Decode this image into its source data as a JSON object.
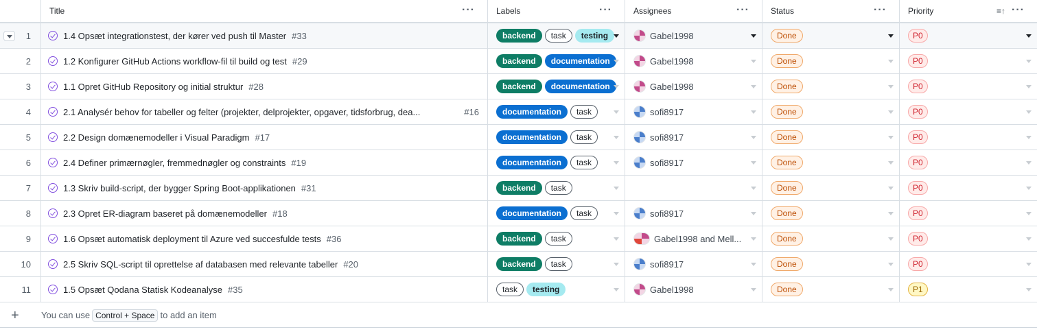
{
  "columns": {
    "title": "Title",
    "labels": "Labels",
    "assignees": "Assignees",
    "status": "Status",
    "priority": "Priority"
  },
  "header_menu_glyph": "···",
  "rows": [
    {
      "n": "1",
      "title": "1.4 Opsæt integrationstest, der kører ved push til Master",
      "issue": "#33",
      "labels": [
        "backend",
        "task",
        "testing"
      ],
      "assignee": "Gabel1998",
      "avatar": "pink",
      "status": "Done",
      "priority": "P0"
    },
    {
      "n": "2",
      "title": "1.2 Konfigurer GitHub Actions workflow-fil til build og test",
      "issue": "#29",
      "labels": [
        "backend",
        "documentation"
      ],
      "assignee": "Gabel1998",
      "avatar": "pink",
      "status": "Done",
      "priority": "P0"
    },
    {
      "n": "3",
      "title": "1.1 Opret GitHub Repository og initial struktur",
      "issue": "#28",
      "labels": [
        "backend",
        "documentation"
      ],
      "assignee": "Gabel1998",
      "avatar": "pink",
      "status": "Done",
      "priority": "P0"
    },
    {
      "n": "4",
      "title": "2.1 Analysér behov for tabeller og felter (projekter, delprojekter, opgaver, tidsforbrug, dea...",
      "issue": "#16",
      "labels": [
        "documentation",
        "task"
      ],
      "assignee": "sofi8917",
      "avatar": "blue",
      "status": "Done",
      "priority": "P0"
    },
    {
      "n": "5",
      "title": "2.2 Design domænemodeller i Visual Paradigm",
      "issue": "#17",
      "labels": [
        "documentation",
        "task"
      ],
      "assignee": "sofi8917",
      "avatar": "blue",
      "status": "Done",
      "priority": "P0"
    },
    {
      "n": "6",
      "title": "2.4 Definer primærnøgler, fremmednøgler og constraints",
      "issue": "#19",
      "labels": [
        "documentation",
        "task"
      ],
      "assignee": "sofi8917",
      "avatar": "blue",
      "status": "Done",
      "priority": "P0"
    },
    {
      "n": "7",
      "title": "1.3 Skriv build-script, der bygger Spring Boot-applikationen",
      "issue": "#31",
      "labels": [
        "backend",
        "task"
      ],
      "assignee": "",
      "avatar": "",
      "status": "Done",
      "priority": "P0"
    },
    {
      "n": "8",
      "title": "2.3 Opret ER-diagram baseret på domænemodeller",
      "issue": "#18",
      "labels": [
        "documentation",
        "task"
      ],
      "assignee": "sofi8917",
      "avatar": "blue",
      "status": "Done",
      "priority": "P0"
    },
    {
      "n": "9",
      "title": "1.6 Opsæt automatisk deployment til Azure ved succesfulde tests",
      "issue": "#36",
      "labels": [
        "backend",
        "task"
      ],
      "assignee": "Gabel1998 and Mell...",
      "avatar": "multi",
      "status": "Done",
      "priority": "P0"
    },
    {
      "n": "10",
      "title": "2.5 Skriv SQL-script til oprettelse af databasen med relevante tabeller",
      "issue": "#20",
      "labels": [
        "backend",
        "task"
      ],
      "assignee": "sofi8917",
      "avatar": "blue",
      "status": "Done",
      "priority": "P0"
    },
    {
      "n": "11",
      "title": "1.5 Opsæt Qodana Statisk Kodeanalyse",
      "issue": "#35",
      "labels": [
        "task",
        "testing"
      ],
      "assignee": "Gabel1998",
      "avatar": "pink",
      "status": "Done",
      "priority": "P1"
    }
  ],
  "footer": {
    "add_icon": "+",
    "text_before": "You can use",
    "shortcut": "Control + Space",
    "text_after": "to add an item"
  },
  "colors": {
    "backend": "#0e7d65",
    "documentation": "#0b6fd1",
    "testing": "#a5eaf0",
    "done": "#bc4c00",
    "p0": "#cf222e",
    "p1": "#9a6700"
  }
}
